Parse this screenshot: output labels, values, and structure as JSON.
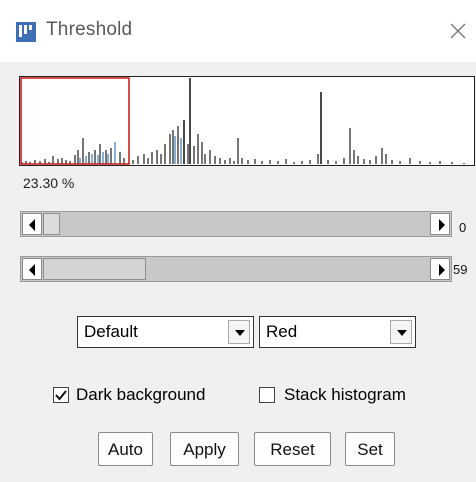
{
  "window": {
    "title": "Threshold",
    "app_icon": "imagej-icon",
    "close_icon": "close-icon"
  },
  "histogram": {
    "percent_label": "23.30 %",
    "colors": {
      "bars": "#1a1a1a",
      "highlight_bars": "#3a7ab0",
      "selection": "#cc2222"
    }
  },
  "sliders": {
    "lower_value": "0",
    "upper_value": "59",
    "lower_position_fraction": 0.0,
    "upper_position_fraction": 0.24
  },
  "controls": {
    "method_selected": "Default",
    "mode_selected": "Red"
  },
  "options": {
    "dark_background_label": "Dark background",
    "dark_background_checked": true,
    "stack_histogram_label": "Stack histogram",
    "stack_histogram_checked": false
  },
  "buttons": {
    "auto": "Auto",
    "apply": "Apply",
    "reset": "Reset",
    "set": "Set"
  }
}
